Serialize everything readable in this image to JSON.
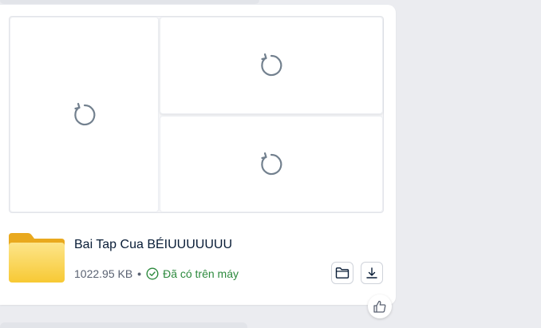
{
  "message": {
    "file": {
      "name": "Bai Tap Cua BÉIUUUUUUU",
      "size": "1022.95 KB",
      "separator": "•",
      "status": "Đã có trên máy"
    },
    "media_tiles": [
      {
        "state": "loading",
        "icon": "reload-icon"
      },
      {
        "state": "loading",
        "icon": "reload-icon"
      },
      {
        "state": "loading",
        "icon": "reload-icon"
      }
    ],
    "actions": {
      "open_folder_icon": "folder-outline-icon",
      "download_icon": "download-icon"
    },
    "reaction_icon": "thumbs-up-icon"
  },
  "colors": {
    "background": "#ebecf0",
    "bubble": "#ffffff",
    "file_name": "#081c36",
    "status_green": "#2d8a3e",
    "icon_gray": "#72808e",
    "folder_yellow": "#f7c934"
  }
}
